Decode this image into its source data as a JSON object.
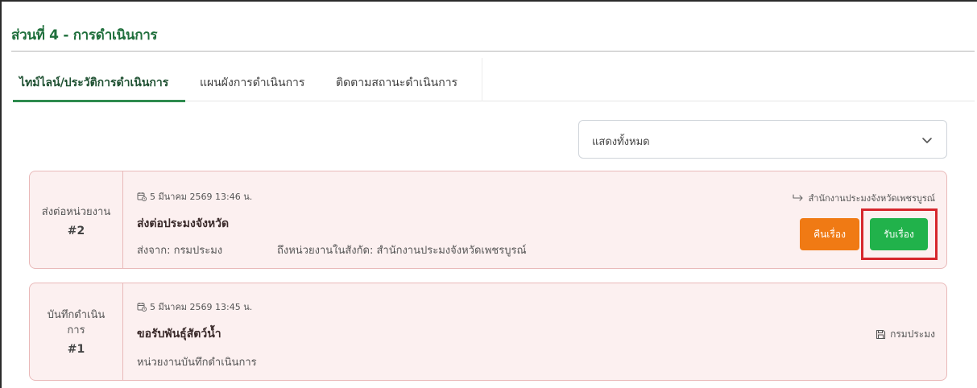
{
  "section": {
    "title": "ส่วนที่ 4 - การดำเนินการ"
  },
  "tabs": [
    {
      "label": "ไทม์ไลน์/ประวัติการดำเนินการ",
      "active": true
    },
    {
      "label": "แผนผังการดำเนินการ",
      "active": false
    },
    {
      "label": "ติดตามสถานะดำเนินการ",
      "active": false
    }
  ],
  "filter": {
    "selected": "แสดงทั้งหมด",
    "icon": "chevron-down-icon"
  },
  "timeline": [
    {
      "side_label": "ส่งต่อหน่วยงาน",
      "number": "#2",
      "date": "5 มีนาคม 2569 13:46 น.",
      "title": "ส่งต่อประมงจังหวัด",
      "from": "ส่งจาก: กรมประมง",
      "to": "ถึงหน่วยงานในสังกัด: สำนักงานประมงจังหวัดเพชรบูรณ์",
      "destination": "สำนักงานประมงจังหวัดเพชรบูรณ์",
      "buttons": {
        "return": "คืนเรื่อง",
        "accept": "รับเรื่อง"
      }
    },
    {
      "side_label": "บันทึกดำเนินการ",
      "number": "#1",
      "date": "5 มีนาคม 2569 13:45 น.",
      "title": "ขอรับพันธุ์สัตว์น้ำ",
      "description": "หน่วยงานบันทึกดำเนินการ",
      "recorder": "กรมประมง"
    }
  ],
  "colors": {
    "brand_green": "#1f6f3c",
    "card_bg": "#fcf0f0",
    "card_border": "#e9b9b9",
    "return_orange": "#f07a14",
    "accept_green": "#21b24b",
    "highlight_red": "#d6262c"
  }
}
